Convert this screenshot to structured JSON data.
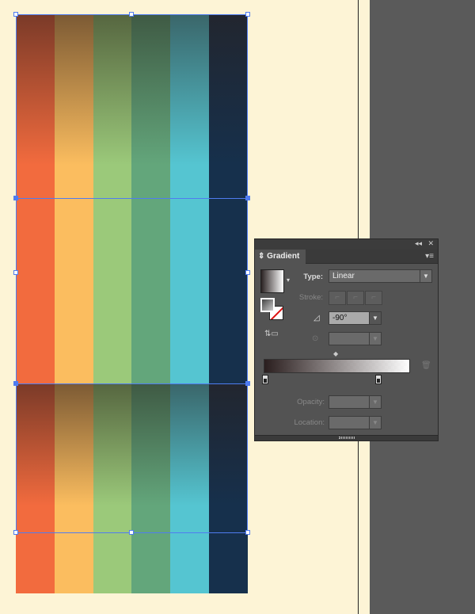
{
  "canvas": {
    "stripe_colors": [
      "#f26b3e",
      "#fbbd5f",
      "#9bc97a",
      "#63a67b",
      "#55c5d1",
      "#16304c"
    ],
    "shade_colors": [
      "#7a3a28",
      "#7c5a34",
      "#566640",
      "#3f5a44",
      "#3a666a",
      "#22262f"
    ],
    "accent": "#4f7cf0"
  },
  "panel": {
    "collapse_icon": "double-chevron-left",
    "close_icon": "close",
    "tab": "Gradient",
    "type_label": "Type:",
    "type_value": "Linear",
    "stroke_label": "Stroke:",
    "angle_value": "-90°",
    "opacity_label": "Opacity:",
    "location_label": "Location:"
  }
}
